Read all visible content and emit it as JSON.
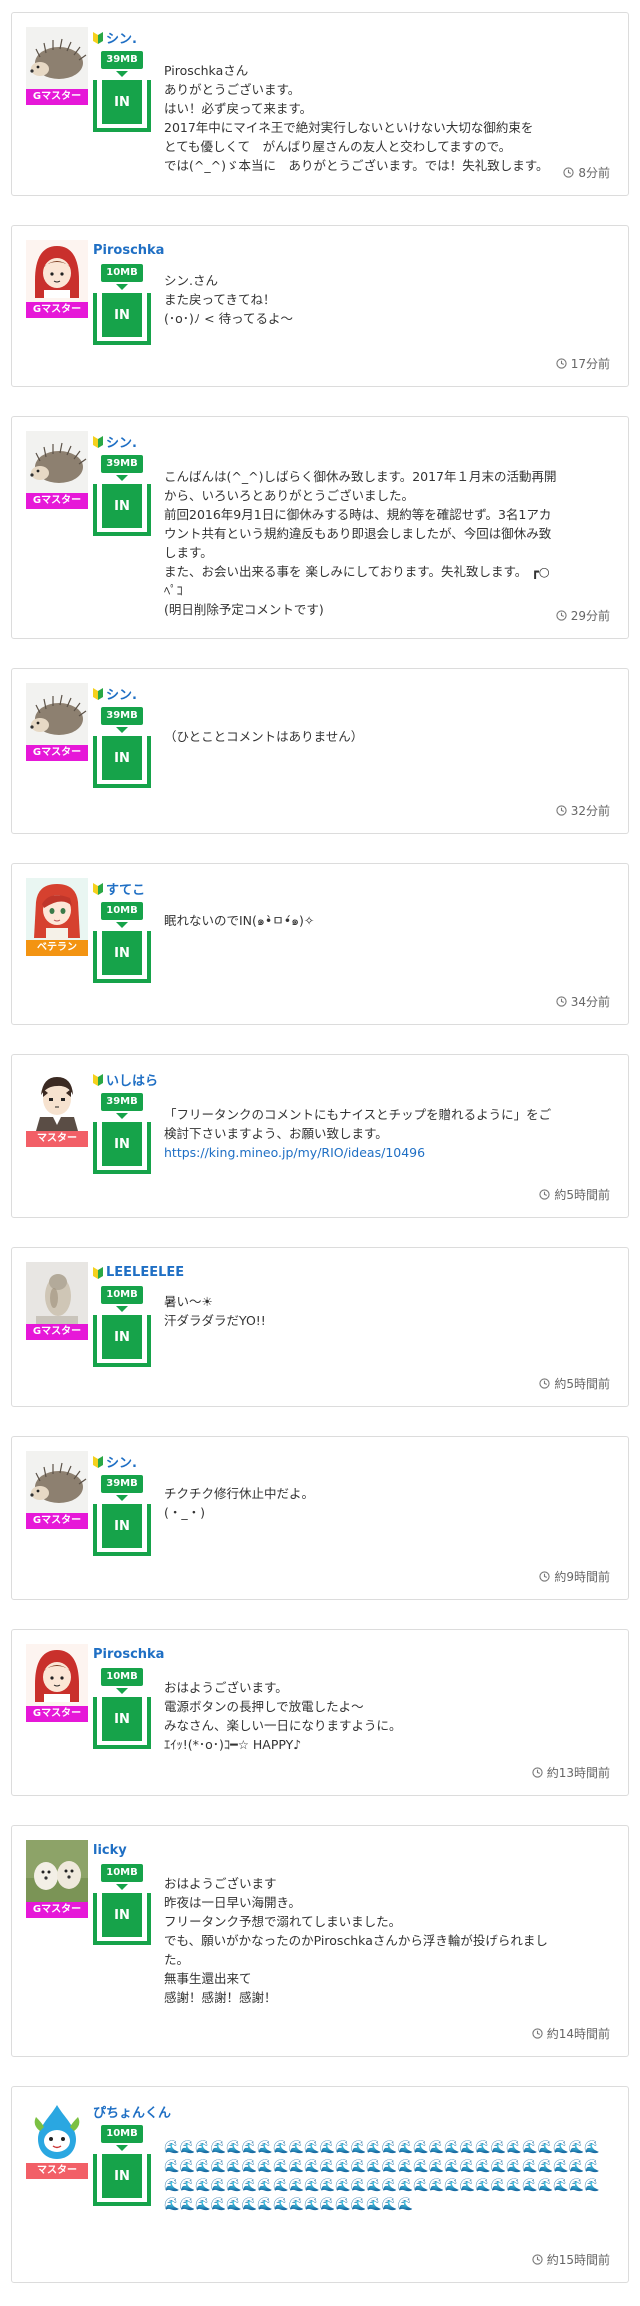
{
  "posts": [
    {
      "user": "シン.",
      "beginner": true,
      "avatar": "hedgehog",
      "rank": "Gマスター",
      "rank_class": "gmaster",
      "mb": "39MB",
      "in_label": "IN",
      "lines": [
        "Piroschkaさん",
        "ありがとうございます。",
        "はい！必ず戻って来ます。",
        "2017年中にマイネ王で絶対実行しないといけない大切な御約束を",
        "とても優しくて　がんばり屋さんの友人と交わしてますので。",
        "では(^_^)ゞ本当に　ありがとうございます。では！失礼致します。"
      ],
      "time": "8分前"
    },
    {
      "user": "Piroschka",
      "beginner": false,
      "avatar": "redhood",
      "rank": "Gマスター",
      "rank_class": "gmaster",
      "mb": "10MB",
      "in_label": "IN",
      "lines": [
        "シン.さん",
        "また戻ってきてね！",
        "(･o･)ﾉ < 待ってるよ～"
      ],
      "time": "17分前"
    },
    {
      "user": "シン.",
      "beginner": true,
      "avatar": "hedgehog",
      "rank": "Gマスター",
      "rank_class": "gmaster",
      "mb": "39MB",
      "in_label": "IN",
      "lines": [
        "こんばんは(^_^)しばらく御休み致します。2017年１月末の活動再開",
        "から、いろいろとありがとうございました。",
        "前回2016年9月1日に御休みする時は、規約等を確認せず。3名1アカ",
        "ウント共有という規約違反もあり即退会しましたが、今回は御休み致",
        "します。",
        "また、お会い出来る事を 楽しみにしております。失礼致します。 ┏○",
        "ﾍﾟｺ",
        "(明日削除予定コメントです)"
      ],
      "time": "29分前"
    },
    {
      "user": "シン.",
      "beginner": true,
      "avatar": "hedgehog",
      "rank": "Gマスター",
      "rank_class": "gmaster",
      "mb": "39MB",
      "in_label": "IN",
      "lines": [
        "（ひとことコメントはありません）"
      ],
      "time": "32分前"
    },
    {
      "user": "すてこ",
      "beginner": true,
      "avatar": "anime",
      "rank": "ベテラン",
      "rank_class": "veteran",
      "mb": "10MB",
      "in_label": "IN",
      "lines": [
        "眠れないのでIN(๑•̀ㅁ•́๑)✧"
      ],
      "time": "34分前"
    },
    {
      "user": "いしはら",
      "beginner": true,
      "avatar": "boy",
      "rank": "マスター",
      "rank_class": "master",
      "mb": "39MB",
      "in_label": "IN",
      "lines": [
        "「フリータンクのコメントにもナイスとチップを贈れるように」をご",
        "検討下さいますよう、お願い致します。"
      ],
      "link": "https://king.mineo.jp/my/RIO/ideas/10496",
      "time": "約5時間前"
    },
    {
      "user": "LEELEELEE",
      "beginner": true,
      "avatar": "object",
      "rank": "Gマスター",
      "rank_class": "gmaster",
      "mb": "10MB",
      "in_label": "IN",
      "lines": [
        "暑い～☀",
        "汗ダラダラだYO!!"
      ],
      "time": "約5時間前"
    },
    {
      "user": "シン.",
      "beginner": true,
      "avatar": "hedgehog",
      "rank": "Gマスター",
      "rank_class": "gmaster",
      "mb": "39MB",
      "in_label": "IN",
      "lines": [
        "チクチク修行休止中だよ。",
        "(・_・)"
      ],
      "time": "約9時間前"
    },
    {
      "user": "Piroschka",
      "beginner": false,
      "avatar": "redhood",
      "rank": "Gマスター",
      "rank_class": "gmaster",
      "mb": "10MB",
      "in_label": "IN",
      "lines": [
        "おはようございます。",
        "電源ボタンの長押しで放電したよ～",
        "みなさん、楽しい一日になりますように。",
        "ｴｲｯ!(*･o･)ｺ━☆ HAPPY♪"
      ],
      "time": "約13時間前"
    },
    {
      "user": "licky",
      "beginner": false,
      "avatar": "dogs",
      "rank": "Gマスター",
      "rank_class": "gmaster",
      "mb": "10MB",
      "in_label": "IN",
      "lines": [
        "おはようございます",
        "昨夜は一日早い海開き。",
        "フリータンク予想で溺れてしまいました。",
        "でも、願いがかなったのかPiroschkaさんから浮き輪が投げられまし",
        "た。",
        "無事生還出来て",
        "感謝！感謝！感謝！"
      ],
      "time": "約14時間前"
    },
    {
      "user": "ぴちょんくん",
      "beginner": false,
      "avatar": "drop",
      "rank": "マスター",
      "rank_class": "master",
      "mb": "10MB",
      "in_label": "IN",
      "lines": [
        "🌊🌊🌊🌊🌊🌊🌊🌊🌊🌊🌊🌊🌊🌊🌊🌊🌊🌊🌊🌊🌊🌊🌊🌊🌊🌊🌊🌊",
        "🌊🌊🌊🌊🌊🌊🌊🌊🌊🌊🌊🌊🌊🌊🌊🌊🌊🌊🌊🌊🌊🌊🌊🌊🌊🌊🌊🌊",
        "🌊🌊🌊🌊🌊🌊🌊🌊🌊🌊🌊🌊🌊🌊🌊🌊🌊🌊🌊🌊🌊🌊🌊🌊🌊🌊🌊🌊",
        "🌊🌊🌊🌊🌊🌊🌊🌊🌊🌊🌊🌊🌊🌊🌊🌊"
      ],
      "time": "約15時間前"
    }
  ]
}
